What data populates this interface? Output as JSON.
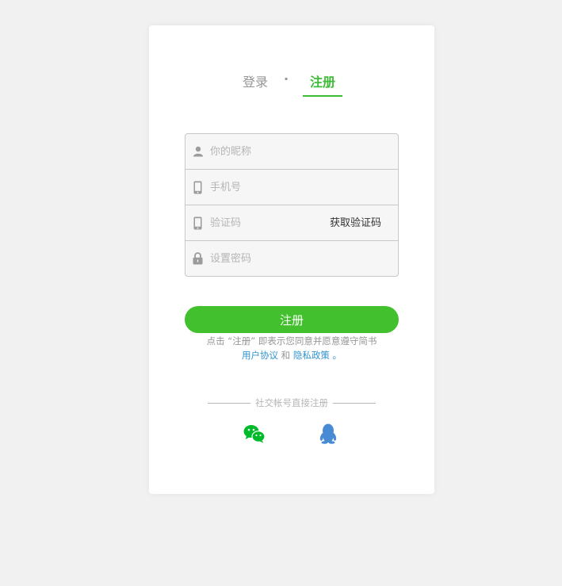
{
  "tabs": {
    "login": "登录",
    "separator": "·",
    "register": "注册"
  },
  "form": {
    "nickname_placeholder": "你的昵称",
    "phone_placeholder": "手机号",
    "code_placeholder": "验证码",
    "get_code_label": "获取验证码",
    "password_placeholder": "设置密码"
  },
  "submit_label": "注册",
  "terms": {
    "prefix": "点击 “注册” 即表示您同意并愿意遵守简书",
    "user_agreement": "用户协议",
    "and": "和",
    "privacy_policy": "隐私政策",
    "suffix": "。"
  },
  "social": {
    "title": "社交帐号直接注册",
    "wechat_icon": "wechat-icon",
    "qq_icon": "qq-icon"
  },
  "colors": {
    "accent": "#3ebc38",
    "button": "#42c02e",
    "link": "#3194d0",
    "qq": "#498ad5"
  }
}
